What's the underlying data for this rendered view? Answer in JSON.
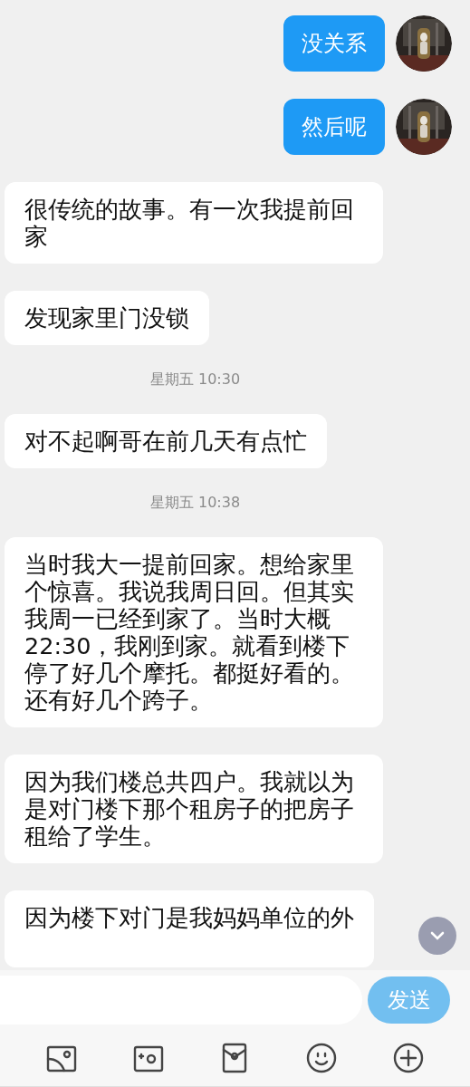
{
  "messages": [
    {
      "kind": "outgoing",
      "text": "没关系"
    },
    {
      "kind": "outgoing",
      "text": "然后呢"
    },
    {
      "kind": "incoming",
      "text": "很传统的故事。有一次我提前回家"
    },
    {
      "kind": "incoming",
      "text": "发现家里门没锁"
    },
    {
      "kind": "time",
      "text": "星期五 10:30"
    },
    {
      "kind": "incoming",
      "text": "对不起啊哥在前几天有点忙"
    },
    {
      "kind": "time",
      "text": "星期五 10:38"
    },
    {
      "kind": "incoming",
      "text": "当时我大一提前回家。想给家里个惊喜。我说我周日回。但其实我周一已经到家了。当时大概22:30，我刚到家。就看到楼下停了好几个摩托。都挺好看的。还有好几个跨子。"
    },
    {
      "kind": "incoming",
      "text": "因为我们楼总共四户。我就以为是对门楼下那个租房子的把房子租给了学生。"
    },
    {
      "kind": "incoming",
      "text": "因为楼下对门是我妈妈单位的外",
      "cut": true
    }
  ],
  "composer": {
    "send": "发送"
  }
}
